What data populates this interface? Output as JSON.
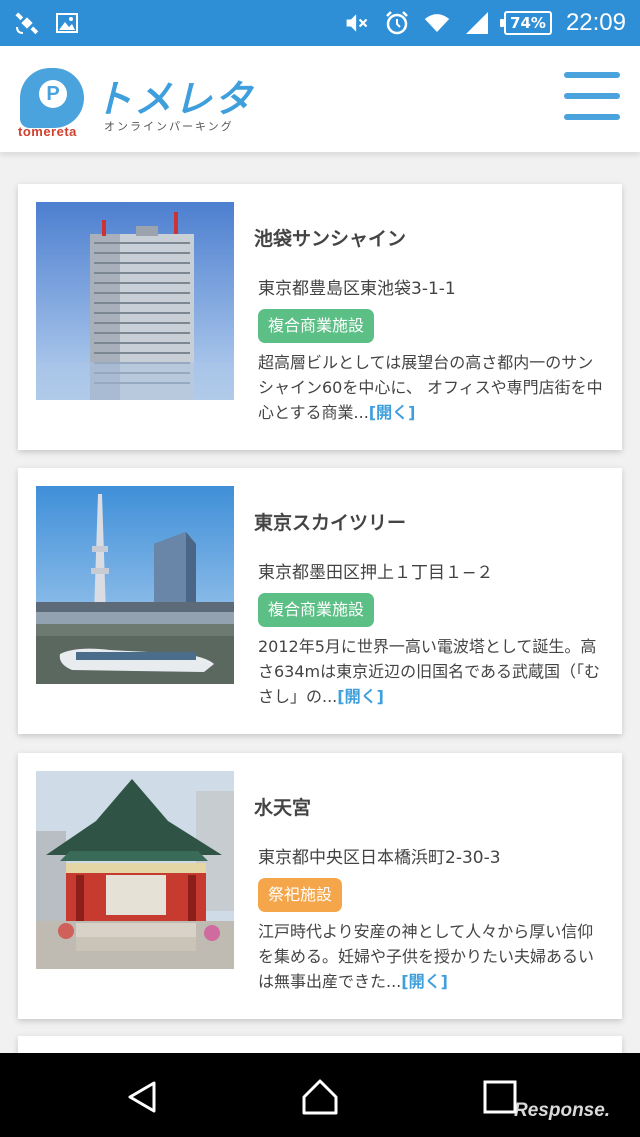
{
  "status_bar": {
    "battery": "74%",
    "time": "22:09"
  },
  "header": {
    "logo_en": "tomereta",
    "logo_jp": "トメレタ",
    "logo_sub": "オンラインパーキング"
  },
  "cards": [
    {
      "title": "池袋サンシャイン",
      "address": "東京都豊島区東池袋3-1-1",
      "tag": "複合商業施設",
      "tag_color": "#5cbf85",
      "description": "超高層ビルとしては展望台の高さ都内一のサンシャイン60を中心に、 オフィスや専門店街を中心とする商業...",
      "more": "[開く]"
    },
    {
      "title": "東京スカイツリー",
      "address": "東京都墨田区押上１丁目１−２",
      "tag": "複合商業施設",
      "tag_color": "#5cbf85",
      "description": "2012年5月に世界一高い電波塔として誕生。高さ634mは東京近辺の旧国名である武蔵国（「むさし」の...",
      "more": "[開く]"
    },
    {
      "title": "水天宮",
      "address": "東京都中央区日本橋浜町2-30-3",
      "tag": "祭祀施設",
      "tag_color": "#f5a64a",
      "description": "江戸時代より安産の神として人々から厚い信仰を集める。妊婦や子供を授かりたい夫婦あるいは無事出産できた...",
      "more": "[開く]"
    }
  ],
  "watermark": "Response.",
  "colors": {
    "status_bar": "#2f8fd6",
    "accent": "#3f9fdc",
    "tag_commercial": "#5cbf85",
    "tag_shrine": "#f5a64a"
  }
}
